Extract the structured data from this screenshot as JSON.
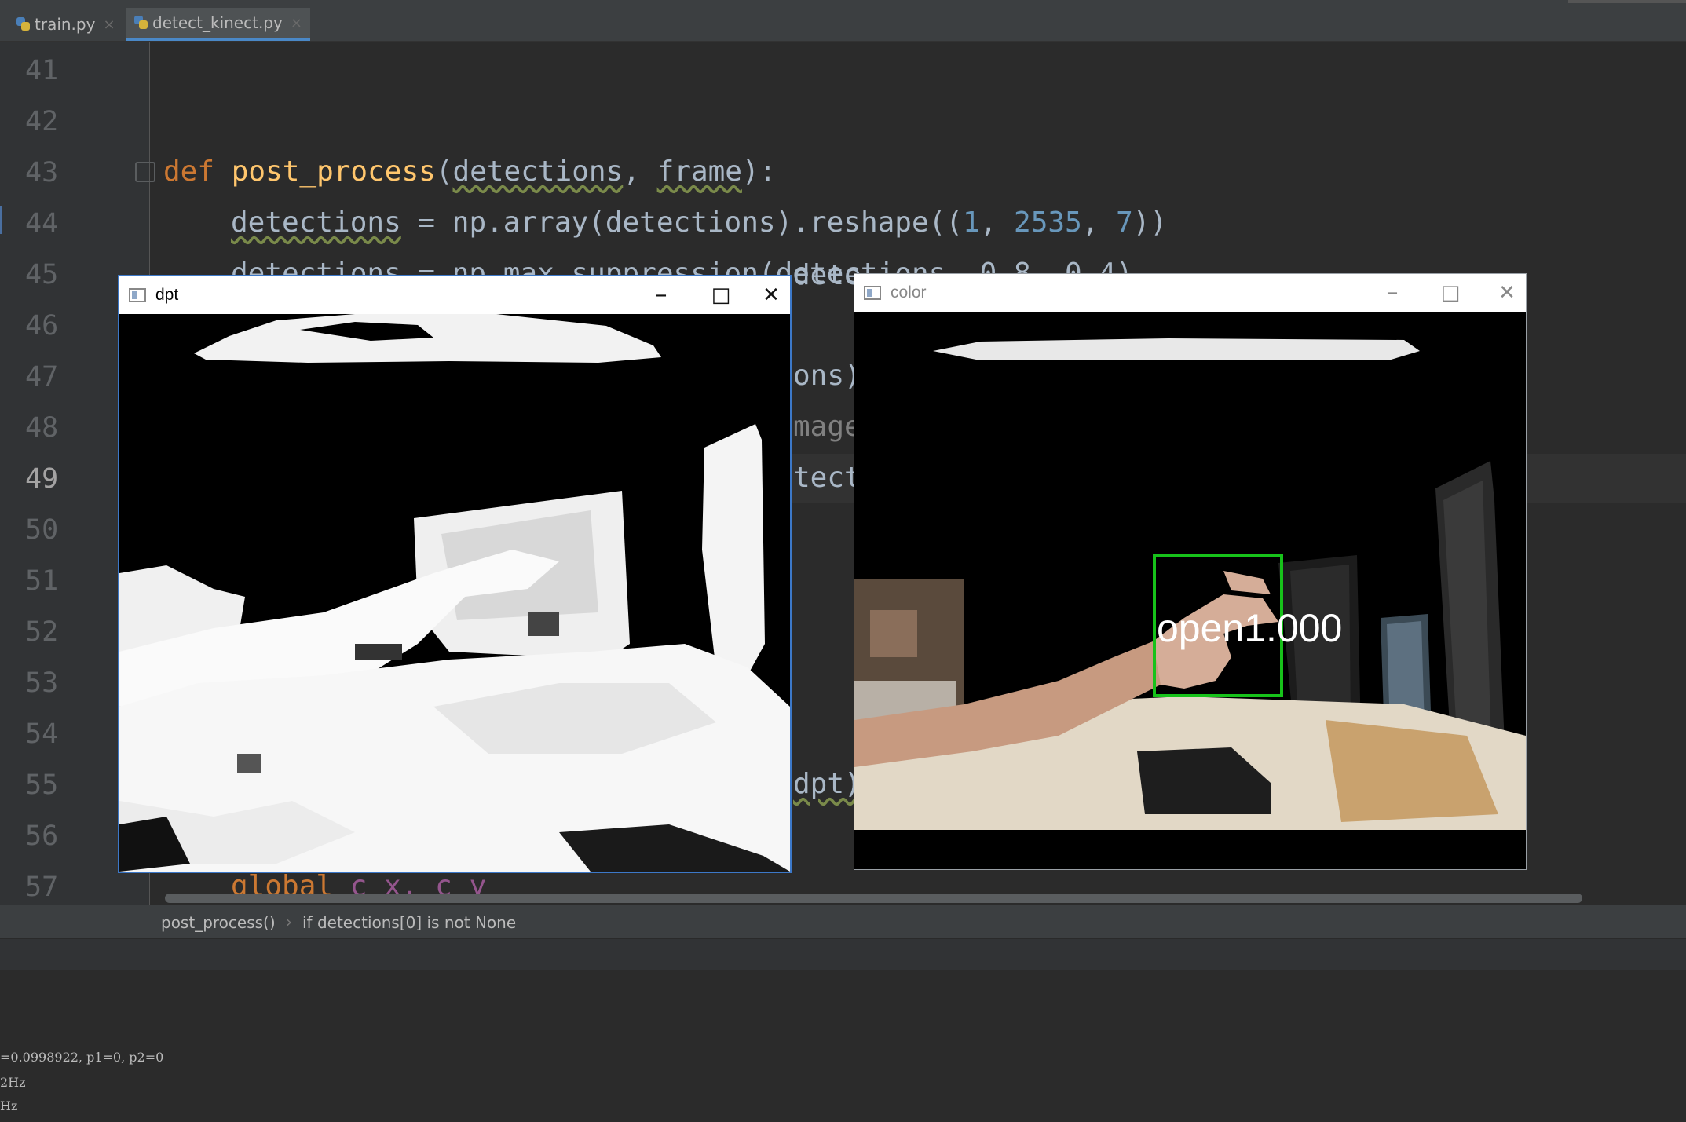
{
  "tabs": [
    {
      "label": "train.py",
      "close": "×",
      "active": false
    },
    {
      "label": "detect_kinect.py",
      "close": "×",
      "active": true
    }
  ],
  "editor": {
    "line_numbers": [
      "41",
      "42",
      "43",
      "44",
      "45",
      "46",
      "47",
      "48",
      "49",
      "50",
      "51",
      "52",
      "53",
      "54",
      "55",
      "56",
      "57"
    ],
    "current_line": "49",
    "code": {
      "l43_def": "def",
      "l43_fn": "post_process",
      "l43_open": "(",
      "l43_p1": "detections",
      "l43_comma": ", ",
      "l43_p2": "frame",
      "l43_close": "):",
      "l44_var": "detections",
      "l44_rest1": " = np.array(detections).reshape((",
      "l44_n1": "1",
      "l44_sep1": ", ",
      "l44_n2": "2535",
      "l44_sep2": ", ",
      "l44_n3": "7",
      "l44_rest2": "))",
      "l45_partial": "detections = np.max_suppression(detections, 0.8, 0.4)",
      "l57_kw": "global",
      "l57_rest": " c_x, c_y"
    },
    "behind_window_fragments": {
      "f45": "dete",
      "f47": "ons)",
      "f48": "mage",
      "f49": "tect",
      "f55": "dpt)"
    }
  },
  "breadcrumb": {
    "items": [
      "post_process()",
      "if detections[0] is not None"
    ],
    "separator": "›"
  },
  "console": {
    "lines": [
      "=0.0998922, p1=0, p2=0",
      "2Hz",
      "Hz"
    ]
  },
  "windows": {
    "dpt": {
      "title": "dpt",
      "minimize": "–",
      "maximize": "□",
      "close": "✕"
    },
    "color": {
      "title": "color",
      "minimize": "–",
      "maximize": "□",
      "close": "✕",
      "detection_label": "open1.000",
      "box_color": "#17c21a"
    }
  }
}
